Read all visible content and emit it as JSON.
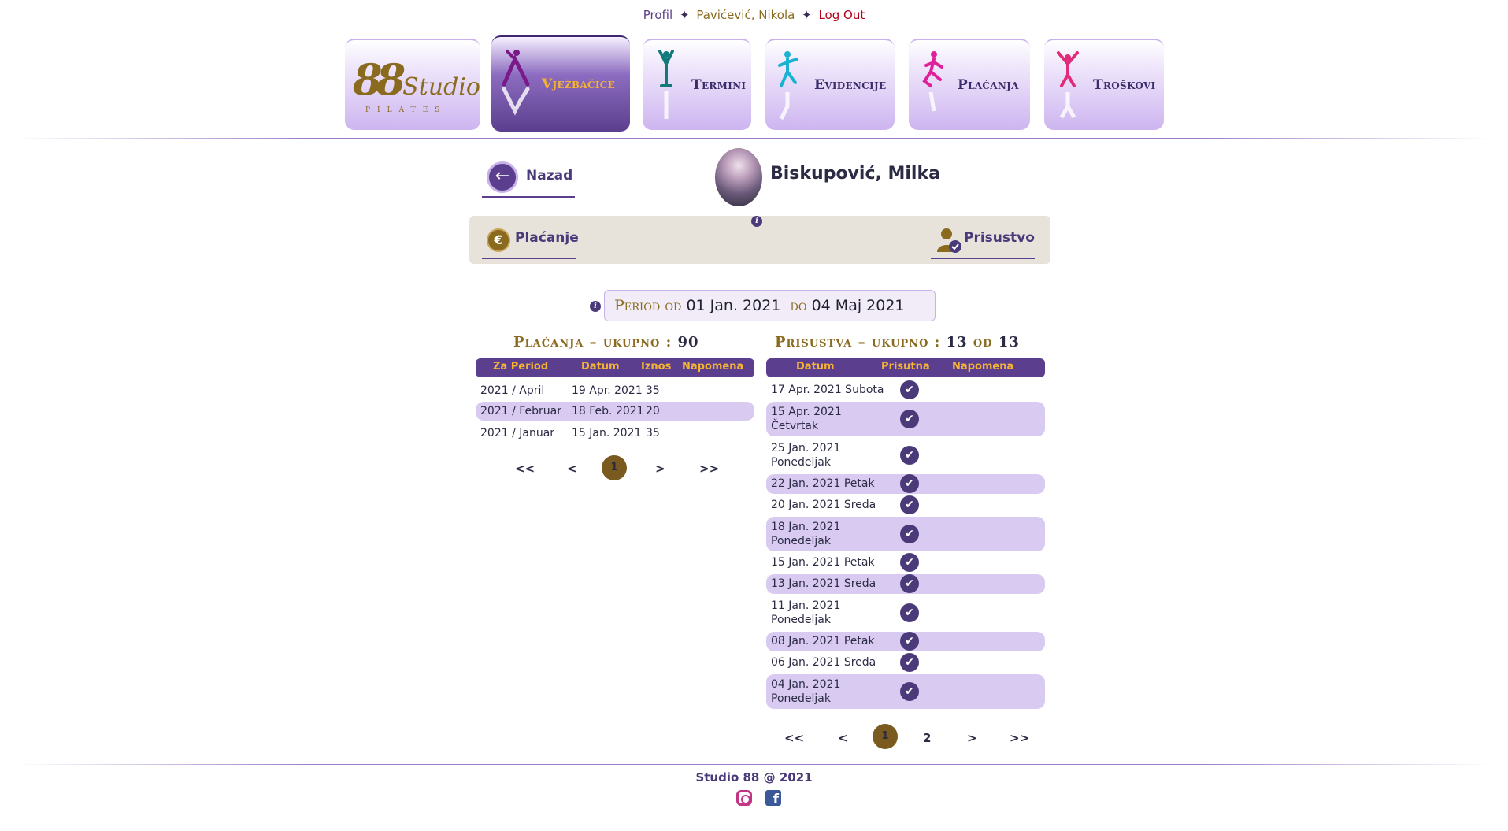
{
  "toplinks": {
    "profil": "Profil",
    "user": "Pavićević, Nikola",
    "logout": "Log Out",
    "sep": "✦"
  },
  "nav": {
    "logo": {
      "big": "88",
      "word": "Studio",
      "sub": "PILATES"
    },
    "items": [
      {
        "label": "Vježbačice",
        "active": true
      },
      {
        "label": "Termini",
        "active": false
      },
      {
        "label": "Evidencije",
        "active": false
      },
      {
        "label": "Plaćanja",
        "active": false
      },
      {
        "label": "Troškovi",
        "active": false
      }
    ]
  },
  "back": {
    "label": "Nazad"
  },
  "person": {
    "name": "Biskupović, Milka"
  },
  "actions": {
    "payment": "Plaćanje",
    "attendance": "Prisustvo",
    "info": "i"
  },
  "period": {
    "label": "Period od",
    "from": "01 Jan. 2021",
    "to_label": "do",
    "to": "04 Maj 2021"
  },
  "payments": {
    "heading": "Plaćanja – ukupno : ",
    "total": "90",
    "columns": [
      "Za Period",
      "Datum",
      "Iznos",
      "Napomena"
    ],
    "rows": [
      {
        "period": "2021 / April",
        "date": "19 Apr. 2021",
        "amount": "35",
        "note": ""
      },
      {
        "period": "2021 / Februar",
        "date": "18 Feb. 2021",
        "amount": "20",
        "note": ""
      },
      {
        "period": "2021 / Januar",
        "date": "15 Jan. 2021",
        "amount": "35",
        "note": ""
      }
    ],
    "pager": {
      "first": "<<",
      "prev": "<",
      "current": "1",
      "next": ">",
      "last": ">>"
    }
  },
  "attendance": {
    "heading": "Prisustva – ukupno : ",
    "count": "13",
    "of_label": "od",
    "of": "13",
    "columns": [
      "Datum",
      "Prisutna",
      "Napomena"
    ],
    "rows": [
      {
        "date1": "17 Apr. 2021 Subota",
        "date2": "",
        "present": true
      },
      {
        "date1": "15 Apr. 2021",
        "date2": "Četvrtak",
        "present": true
      },
      {
        "date1": "25 Jan. 2021",
        "date2": "Ponedeljak",
        "present": true
      },
      {
        "date1": "22 Jan. 2021 Petak",
        "date2": "",
        "present": true
      },
      {
        "date1": "20 Jan. 2021 Sreda",
        "date2": "",
        "present": true
      },
      {
        "date1": "18 Jan. 2021",
        "date2": "Ponedeljak",
        "present": true
      },
      {
        "date1": "15 Jan. 2021 Petak",
        "date2": "",
        "present": true
      },
      {
        "date1": "13 Jan. 2021 Sreda",
        "date2": "",
        "present": true
      },
      {
        "date1": "11 Jan. 2021",
        "date2": "Ponedeljak",
        "present": true
      },
      {
        "date1": "08 Jan. 2021 Petak",
        "date2": "",
        "present": true
      },
      {
        "date1": "06 Jan. 2021 Sreda",
        "date2": "",
        "present": true
      },
      {
        "date1": "04 Jan. 2021",
        "date2": "Ponedeljak",
        "present": true
      }
    ],
    "pager": {
      "first": "<<",
      "prev": "<",
      "current": "1",
      "page2": "2",
      "next": ">",
      "last": ">>"
    }
  },
  "footer": {
    "text": "Studio 88 @ 2021"
  },
  "colors": {
    "accent": "#5b3f8e",
    "gold": "#8a6a1f",
    "orange": "#f5b335",
    "row_alt": "#d9caf2"
  },
  "icons": [
    "back-arrow-icon",
    "euro-coin-icon",
    "attendance-user-check-icon",
    "info-icon",
    "check-icon",
    "instagram-icon",
    "facebook-icon"
  ]
}
